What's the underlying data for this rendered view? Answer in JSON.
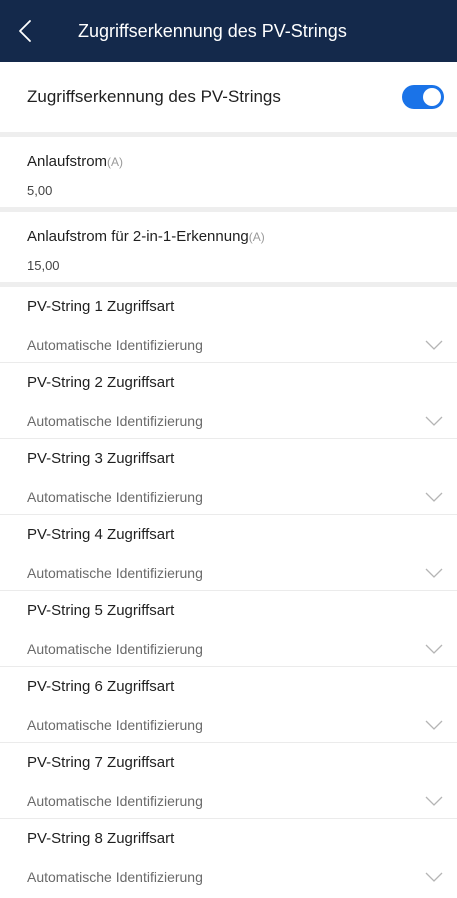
{
  "header": {
    "title": "Zugriffserkennung des PV-Strings",
    "back_icon": "chevron-left-icon"
  },
  "toggle_row": {
    "label": "Zugriffserkennung des PV-Strings",
    "enabled": true,
    "color": "#1a73e8"
  },
  "fields": [
    {
      "label": "Anlaufstrom",
      "unit": "(A)",
      "value": "5,00"
    },
    {
      "label": "Anlaufstrom für 2-in-1-Erkennung",
      "unit": "(A)",
      "value": "15,00"
    }
  ],
  "strings": [
    {
      "label": "PV-String 1 Zugriffsart",
      "value": "Automatische Identifizierung"
    },
    {
      "label": "PV-String 2 Zugriffsart",
      "value": "Automatische Identifizierung"
    },
    {
      "label": "PV-String 3 Zugriffsart",
      "value": "Automatische Identifizierung"
    },
    {
      "label": "PV-String 4 Zugriffsart",
      "value": "Automatische Identifizierung"
    },
    {
      "label": "PV-String 5 Zugriffsart",
      "value": "Automatische Identifizierung"
    },
    {
      "label": "PV-String 6 Zugriffsart",
      "value": "Automatische Identifizierung"
    },
    {
      "label": "PV-String 7 Zugriffsart",
      "value": "Automatische Identifizierung"
    },
    {
      "label": "PV-String 8 Zugriffsart",
      "value": "Automatische Identifizierung"
    }
  ],
  "colors": {
    "header_bg": "#14294b",
    "accent": "#1a73e8"
  }
}
